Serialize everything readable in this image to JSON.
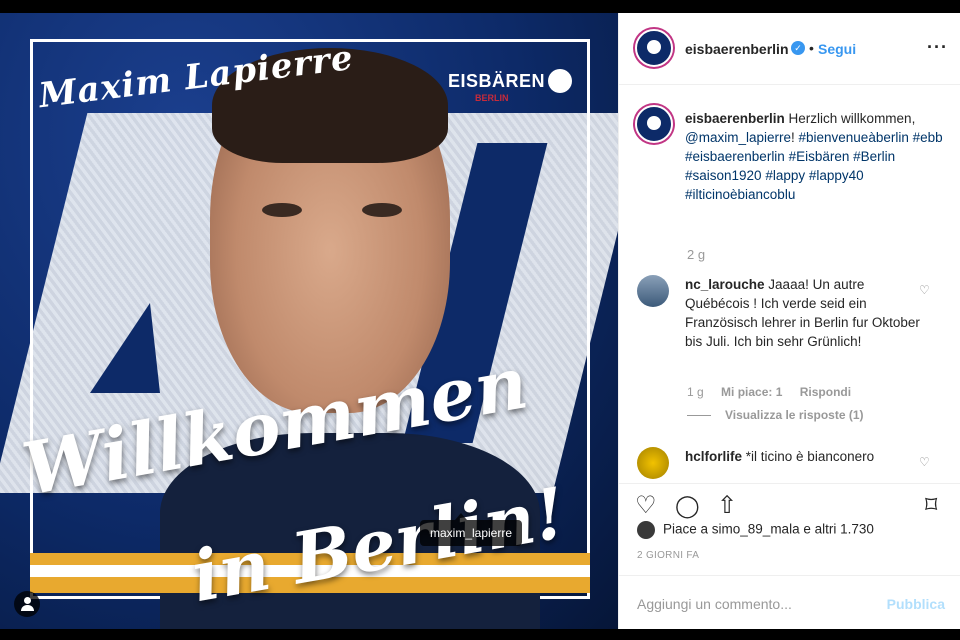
{
  "photo": {
    "name_script": "Maxim Lapierre",
    "brand": "EISBÄREN",
    "brand_sub": "BERLIN",
    "welcome_line1": "Willkommen",
    "welcome_line2": "in Berlin!",
    "tag_label": "maxim_lapierre"
  },
  "header": {
    "username": "eisbaerenberlin",
    "verified_mark": "✓",
    "separator": "•",
    "follow_label": "Segui",
    "more_label": "···"
  },
  "caption": {
    "username": "eisbaerenberlin",
    "text_before": " Herzlich willkommen, ",
    "mention": "@maxim_lapierre",
    "text_after": "! ",
    "hashtags": "#bienvenueàberlin #ebb #eisbaerenberlin #Eisbären #Berlin #saison1920 #lappy #lappy40 #ilticinoèbiancoblu",
    "age": "2 g"
  },
  "comments": [
    {
      "username": "nc_larouche",
      "text": "Jaaaa! Un autre Québécois ! Ich verde seid ein Französisch lehrer in Berlin fur Oktober bis Juli. Ich bin sehr Grünlich!",
      "age": "1 g",
      "likes": "Mi piace: 1",
      "reply": "Rispondi",
      "view_replies": "Visualizza le risposte (1)"
    },
    {
      "username": "hclforlife",
      "text": "*il ticino è bianconero"
    }
  ],
  "actions": {
    "like_icon": "♡",
    "comment_icon": "◯",
    "share_icon": "⇧",
    "save_icon": "⌑"
  },
  "likes": {
    "prefix": "Piace a ",
    "user": "simo_89_mala",
    "middle": " e ",
    "others": "altri 1.730"
  },
  "timestamp": "2 GIORNI FA",
  "add_comment": {
    "placeholder": "Aggiungi un commento...",
    "publish_label": "Pubblica"
  },
  "colors": {
    "link": "#3897f0",
    "brand_blue": "#0d2a68",
    "stripe_gold": "#e8a92f"
  }
}
